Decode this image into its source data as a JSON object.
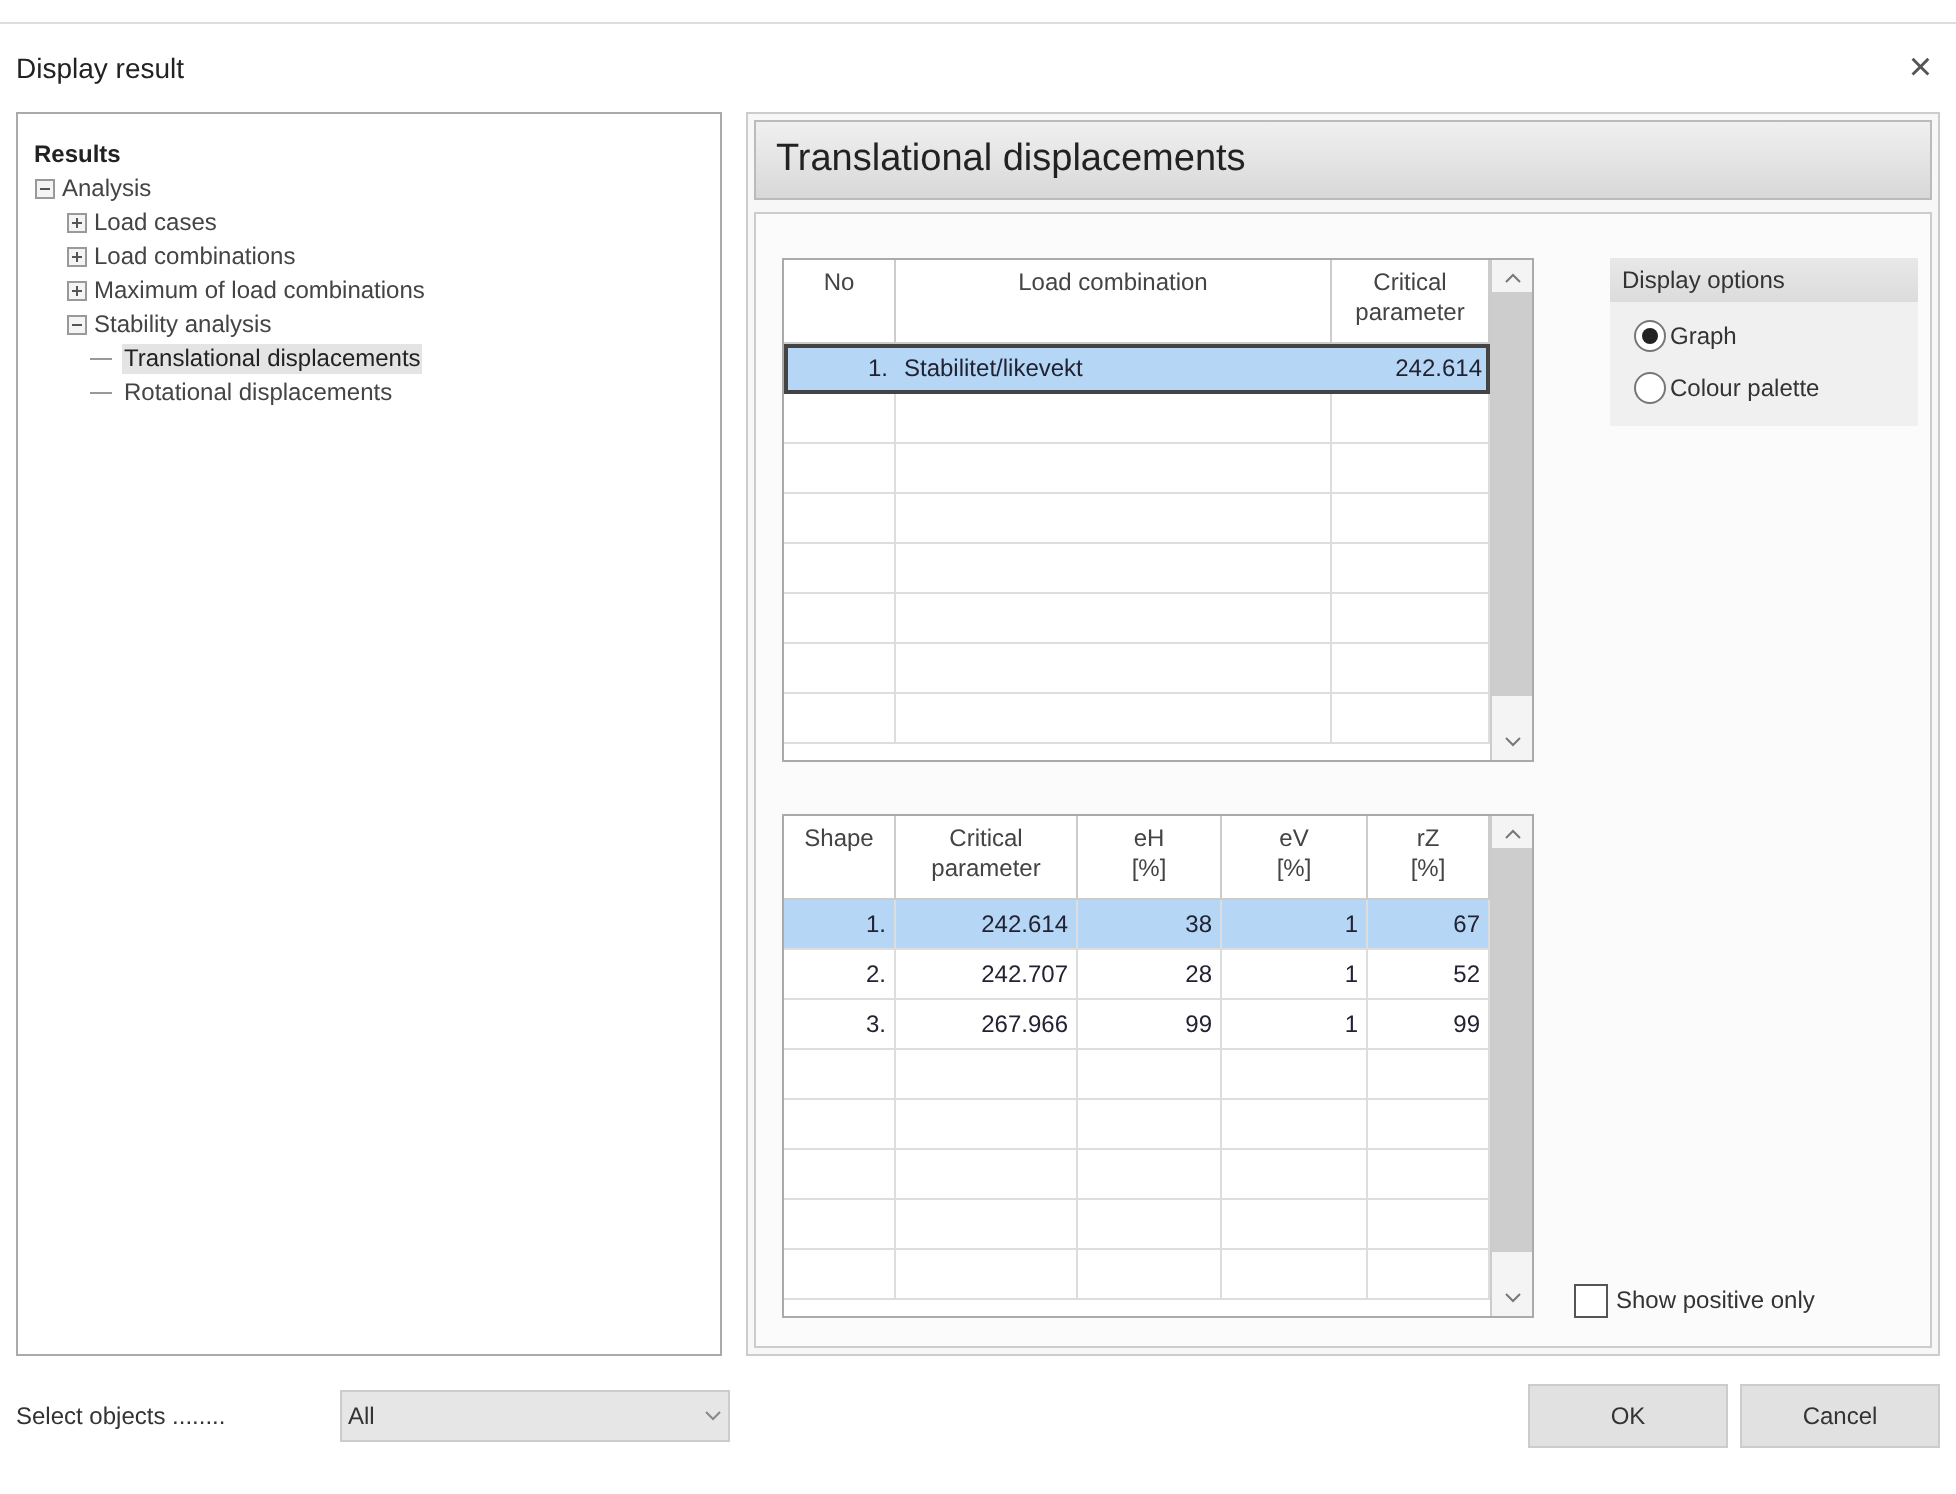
{
  "window": {
    "title": "Display result",
    "close": "×"
  },
  "tree": {
    "root": "Results",
    "items": [
      {
        "label": "Analysis",
        "expanded": true,
        "selected": false,
        "children": [
          {
            "label": "Load cases",
            "expanded": false,
            "selected": false
          },
          {
            "label": "Load combinations",
            "expanded": false,
            "selected": false
          },
          {
            "label": "Maximum of load combinations",
            "expanded": false,
            "selected": false
          },
          {
            "label": "Stability analysis",
            "expanded": true,
            "selected": false,
            "children": [
              {
                "label": "Translational displacements",
                "selected": true
              },
              {
                "label": "Rotational displacements",
                "selected": false
              }
            ]
          }
        ]
      }
    ]
  },
  "panel_title": "Translational displacements",
  "combinations_table": {
    "columns": [
      "No",
      "Load combination",
      "Critical\nparameter"
    ],
    "rows": [
      {
        "cells": [
          "1.",
          "Stabilitet/likevekt",
          "242.614"
        ],
        "selected": true
      }
    ]
  },
  "shapes_table": {
    "columns": [
      "Shape",
      "Critical\nparameter",
      "eH\n[%]",
      "eV\n[%]",
      "rZ\n[%]"
    ],
    "rows": [
      {
        "cells": [
          "1.",
          "242.614",
          "38",
          "1",
          "67"
        ],
        "selected": true
      },
      {
        "cells": [
          "2.",
          "242.707",
          "28",
          "1",
          "52"
        ],
        "selected": false
      },
      {
        "cells": [
          "3.",
          "267.966",
          "99",
          "1",
          "99"
        ],
        "selected": false
      }
    ]
  },
  "display_options": {
    "title": "Display options",
    "options": [
      {
        "label": "Graph",
        "selected": true
      },
      {
        "label": "Colour palette",
        "selected": false
      }
    ]
  },
  "show_positive_only": {
    "label": "Show positive only",
    "checked": false
  },
  "select_objects": {
    "label": "Select objects ........",
    "value": "All"
  },
  "buttons": [
    "OK",
    "Cancel"
  ]
}
